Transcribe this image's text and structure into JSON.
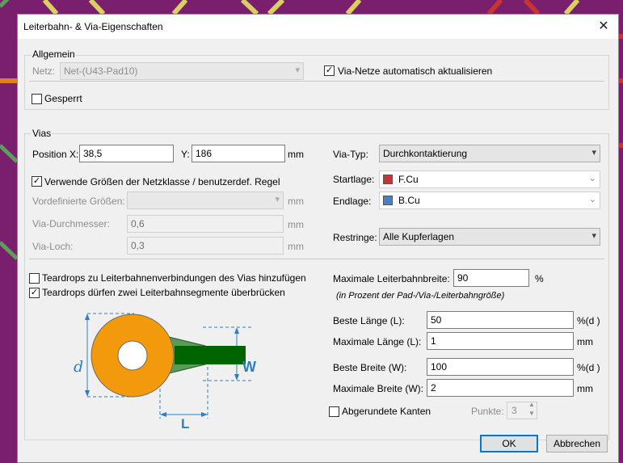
{
  "window": {
    "title": "Leiterbahn- & Via-Eigenschaften",
    "close_glyph": "✕"
  },
  "general": {
    "legend": "Allgemein",
    "net_label": "Netz:",
    "net_value": "Net-(U43-Pad10)",
    "auto_update_label": "Via-Netze automatisch aktualisieren",
    "auto_update_checked": true,
    "locked_label": "Gesperrt",
    "locked_checked": false
  },
  "vias": {
    "legend": "Vias",
    "pos_x_label": "Position X:",
    "pos_x_value": "38,5",
    "pos_y_label": "Y:",
    "pos_y_value": "186",
    "pos_unit": "mm",
    "use_netclass_label": "Verwende Größen der Netzklasse / benutzerdef. Regel",
    "use_netclass_checked": true,
    "predefined_label": "Vordefinierte Größen:",
    "predefined_value": "",
    "predefined_unit": "mm",
    "diameter_label": "Via-Durchmesser:",
    "diameter_value": "0,6",
    "diameter_unit": "mm",
    "hole_label": "Via-Loch:",
    "hole_value": "0,3",
    "hole_unit": "mm",
    "via_type_label": "Via-Typ:",
    "via_type_value": "Durchkontaktierung",
    "start_layer_label": "Startlage:",
    "start_layer_value": "F.Cu",
    "start_layer_color": "#c83434",
    "end_layer_label": "Endlage:",
    "end_layer_value": "B.Cu",
    "end_layer_color": "#4d7fc4",
    "annular_label": "Restringe:",
    "annular_value": "Alle Kupferlagen"
  },
  "teardrops": {
    "add_label": "Teardrops zu Leiterbahnenverbindungen des Vias hinzufügen",
    "add_checked": false,
    "bridge_label": "Teardrops dürfen zwei Leiterbahnsegmente überbrücken",
    "bridge_checked": true,
    "max_track_width_label": "Maximale Leiterbahnbreite:",
    "max_track_width_value": "90",
    "max_track_width_unit": "%",
    "max_track_width_hint": "(in Prozent der Pad-/Via-/Leiterbahngröße)",
    "best_length_label": "Beste Länge (L):",
    "best_length_value": "50",
    "best_length_unit": "%(d )",
    "max_length_label": "Maximale Länge (L):",
    "max_length_value": "1",
    "max_length_unit": "mm",
    "best_width_label": "Beste Breite (W):",
    "best_width_value": "100",
    "best_width_unit": "%(d )",
    "max_width_label": "Maximale Breite (W):",
    "max_width_value": "2",
    "max_width_unit": "mm",
    "rounded_label": "Abgerundete Kanten",
    "rounded_checked": false,
    "points_label": "Punkte:",
    "points_value": "3",
    "diagram": {
      "d_label": "d",
      "w_label": "W",
      "l_label": "L"
    }
  },
  "buttons": {
    "ok": "OK",
    "cancel": "Abbrechen"
  },
  "colors": {
    "pad": "#f39a0c",
    "track": "#006400",
    "teardrop": "#5a9a5a",
    "dimension": "#2d7fc1",
    "background": "#7a1f6e",
    "focus": "#0078d7"
  }
}
